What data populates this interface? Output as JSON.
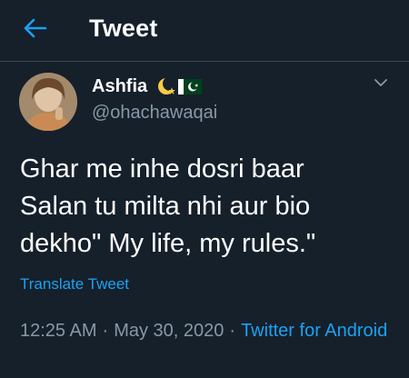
{
  "header": {
    "title": "Tweet",
    "back_icon": "arrow-left-icon",
    "accent_color": "#1da1f2"
  },
  "tweet": {
    "author_name": "Ashfia",
    "author_badges": [
      "moon-star-emoji",
      "pakistan-flag-emoji"
    ],
    "author_handle": "@ohachawaqai",
    "menu_icon": "chevron-down-icon",
    "text": "Ghar me inhe dosri baar\nSalan tu milta nhi aur bio\ndekho\" My life, my rules.\"",
    "translate_label": "Translate Tweet",
    "time": "12:25 AM",
    "separator": "·",
    "date": "May 30, 2020",
    "client": "Twitter for Android"
  },
  "colors": {
    "background": "#15202b",
    "text_primary": "#ffffff",
    "text_secondary": "#8899a6",
    "link": "#1da1f2",
    "divider": "#38444d"
  }
}
